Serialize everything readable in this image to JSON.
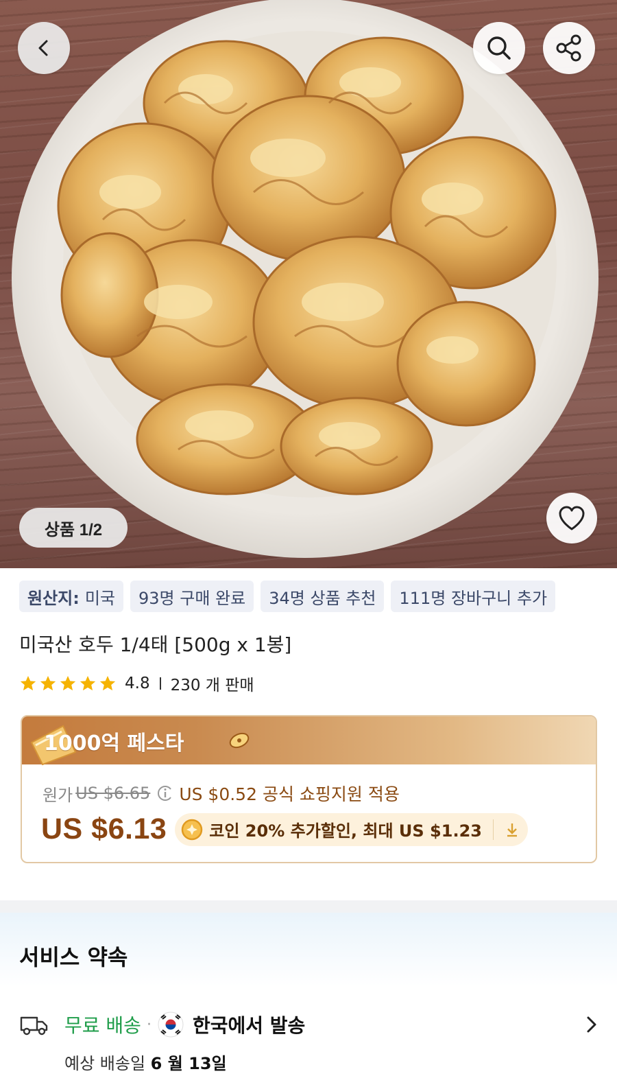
{
  "gallery": {
    "counter": "상품 1/2"
  },
  "icons": {
    "back": "chevron-left-icon",
    "search": "search-icon",
    "share": "share-icon",
    "favorite": "heart-icon",
    "star": "star-icon",
    "info": "info-icon",
    "coin": "coin-icon",
    "download": "download-icon",
    "truck": "truck-icon",
    "flag": "korea-flag-icon",
    "chevron_right": "chevron-right-icon"
  },
  "tags": {
    "origin_label": "원산지:",
    "origin_value": "미국",
    "purchased": "93명 구매 완료",
    "recommended": "34명 상품 추천",
    "cart_added": "111명 장바구니 추가"
  },
  "product": {
    "title": "미국산 호두 1/4태  [500g x 1봉]",
    "rating": "4.8",
    "rating_stars": 5,
    "sold": "230 개 판매"
  },
  "price": {
    "festival_title": "1000억 페스타",
    "original_label": "원가",
    "original_price": "US $6.65",
    "subsidy_text": "US $0.52 공식 쇼핑지원 적용",
    "current_price": "US $6.13",
    "coin_offer": "코인 20% 추가할인, 최대 US $1.23"
  },
  "service": {
    "title": "서비스 약속",
    "free_shipping": "무료 배송",
    "separator": "·",
    "ships_from": "한국에서 발송",
    "eta_label": "예상 배송일",
    "eta_date": "6 월 13일"
  },
  "colors": {
    "accent_brown": "#8a4512",
    "free_shipping_green": "#1f9d4a",
    "tag_bg": "#eef0f6",
    "star_yellow": "#f5b301"
  }
}
